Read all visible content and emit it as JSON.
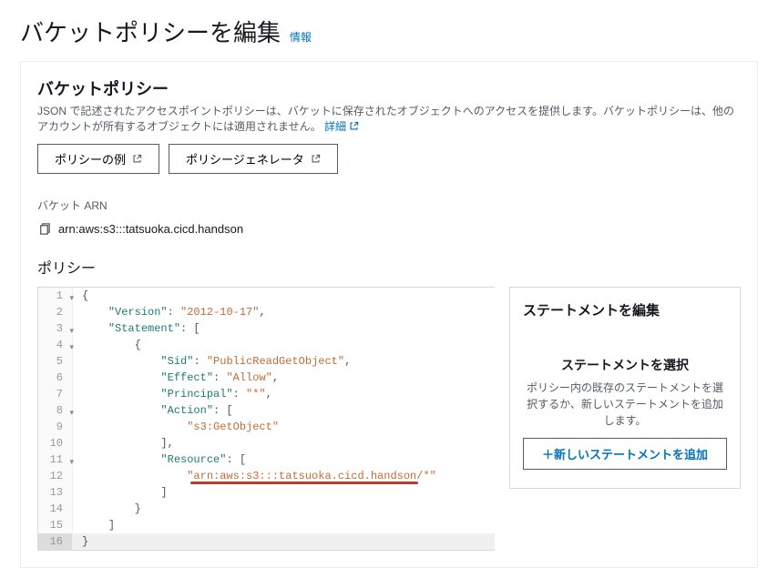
{
  "header": {
    "title": "バケットポリシーを編集",
    "info_label": "情報"
  },
  "policy_panel": {
    "title": "バケットポリシー",
    "description_1": "JSON で記述されたアクセスポイントポリシーは、バケットに保存されたオブジェクトへのアクセスを提供します。バケットポリシーは、他のアカウントが所有するオブジェクトには適用されません。",
    "detail_link": "詳細",
    "btn_examples": "ポリシーの例",
    "btn_generator": "ポリシージェネレータ"
  },
  "arn_section": {
    "label": "バケット ARN",
    "value": "arn:aws:s3:::tatsuoka.cicd.handson"
  },
  "policy_section": {
    "label": "ポリシー"
  },
  "code": {
    "lines": [
      {
        "n": 1,
        "fold": true,
        "ind": 0,
        "tokens": [
          [
            "punc",
            "{"
          ]
        ]
      },
      {
        "n": 2,
        "fold": false,
        "ind": 1,
        "tokens": [
          [
            "key",
            "\"Version\""
          ],
          [
            "punc",
            ": "
          ],
          [
            "str",
            "\"2012-10-17\""
          ],
          [
            "punc",
            ","
          ]
        ]
      },
      {
        "n": 3,
        "fold": true,
        "ind": 1,
        "tokens": [
          [
            "key",
            "\"Statement\""
          ],
          [
            "punc",
            ": ["
          ]
        ]
      },
      {
        "n": 4,
        "fold": true,
        "ind": 2,
        "tokens": [
          [
            "punc",
            "{"
          ]
        ]
      },
      {
        "n": 5,
        "fold": false,
        "ind": 3,
        "tokens": [
          [
            "key",
            "\"Sid\""
          ],
          [
            "punc",
            ": "
          ],
          [
            "str",
            "\"PublicReadGetObject\""
          ],
          [
            "punc",
            ","
          ]
        ]
      },
      {
        "n": 6,
        "fold": false,
        "ind": 3,
        "tokens": [
          [
            "key",
            "\"Effect\""
          ],
          [
            "punc",
            ": "
          ],
          [
            "str",
            "\"Allow\""
          ],
          [
            "punc",
            ","
          ]
        ]
      },
      {
        "n": 7,
        "fold": false,
        "ind": 3,
        "tokens": [
          [
            "key",
            "\"Principal\""
          ],
          [
            "punc",
            ": "
          ],
          [
            "str",
            "\"*\""
          ],
          [
            "punc",
            ","
          ]
        ]
      },
      {
        "n": 8,
        "fold": true,
        "ind": 3,
        "tokens": [
          [
            "key",
            "\"Action\""
          ],
          [
            "punc",
            ": ["
          ]
        ]
      },
      {
        "n": 9,
        "fold": false,
        "ind": 4,
        "tokens": [
          [
            "str",
            "\"s3:GetObject\""
          ]
        ]
      },
      {
        "n": 10,
        "fold": false,
        "ind": 3,
        "tokens": [
          [
            "punc",
            "],"
          ]
        ]
      },
      {
        "n": 11,
        "fold": true,
        "ind": 3,
        "tokens": [
          [
            "key",
            "\"Resource\""
          ],
          [
            "punc",
            ": ["
          ]
        ]
      },
      {
        "n": 12,
        "fold": false,
        "ind": 4,
        "tokens": [
          [
            "str",
            "\"arn:aws:s3:::tatsuoka.cicd.handson/*\""
          ]
        ],
        "underline": true
      },
      {
        "n": 13,
        "fold": false,
        "ind": 3,
        "tokens": [
          [
            "punc",
            "]"
          ]
        ]
      },
      {
        "n": 14,
        "fold": false,
        "ind": 2,
        "tokens": [
          [
            "punc",
            "}"
          ]
        ]
      },
      {
        "n": 15,
        "fold": false,
        "ind": 1,
        "tokens": [
          [
            "punc",
            "]"
          ]
        ]
      },
      {
        "n": 16,
        "fold": false,
        "ind": 0,
        "tokens": [
          [
            "punc",
            "}"
          ]
        ],
        "active": true
      }
    ]
  },
  "statement_panel": {
    "title": "ステートメントを編集",
    "subtitle": "ステートメントを選択",
    "description": "ポリシー内の既存のステートメントを選択するか、新しいステートメントを追加します。",
    "add_btn_label": "新しいステートメントを追加"
  }
}
